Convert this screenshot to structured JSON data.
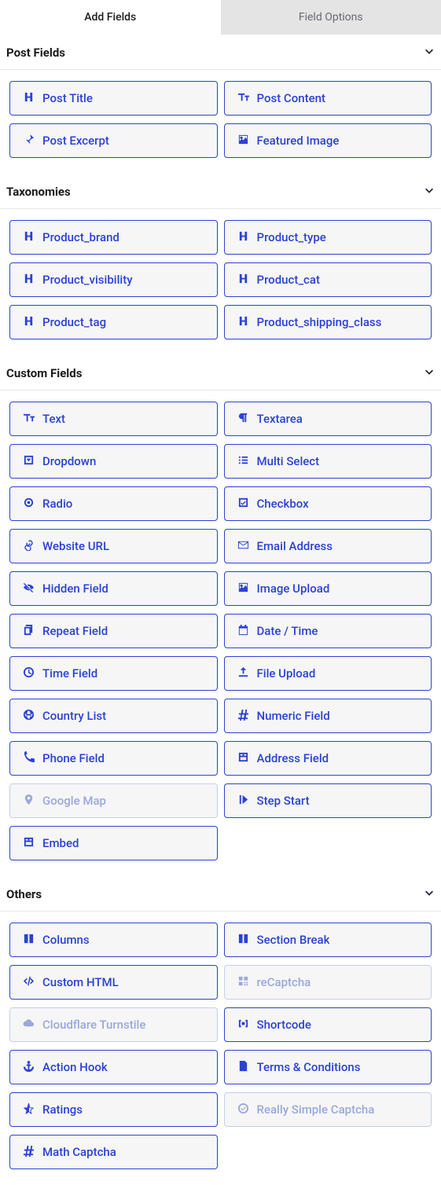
{
  "tabs": {
    "add_fields": "Add Fields",
    "field_options": "Field Options"
  },
  "sections": [
    {
      "title": "Post Fields",
      "items": [
        {
          "icon": "heading",
          "label": "Post Title"
        },
        {
          "icon": "textsize",
          "label": "Post Content"
        },
        {
          "icon": "pushpin",
          "label": "Post Excerpt"
        },
        {
          "icon": "image",
          "label": "Featured Image"
        }
      ]
    },
    {
      "title": "Taxonomies",
      "items": [
        {
          "icon": "heading",
          "label": "Product_brand"
        },
        {
          "icon": "heading",
          "label": "Product_type"
        },
        {
          "icon": "heading",
          "label": "Product_visibility"
        },
        {
          "icon": "heading",
          "label": "Product_cat"
        },
        {
          "icon": "heading",
          "label": "Product_tag"
        },
        {
          "icon": "heading",
          "label": "Product_shipping_class"
        }
      ]
    },
    {
      "title": "Custom Fields",
      "items": [
        {
          "icon": "textsize",
          "label": "Text"
        },
        {
          "icon": "para",
          "label": "Textarea"
        },
        {
          "icon": "dropdown",
          "label": "Dropdown"
        },
        {
          "icon": "list",
          "label": "Multi Select"
        },
        {
          "icon": "radio",
          "label": "Radio"
        },
        {
          "icon": "check",
          "label": "Checkbox"
        },
        {
          "icon": "link",
          "label": "Website URL"
        },
        {
          "icon": "envelope",
          "label": "Email Address"
        },
        {
          "icon": "eyeoff",
          "label": "Hidden Field"
        },
        {
          "icon": "image",
          "label": "Image Upload"
        },
        {
          "icon": "copy",
          "label": "Repeat Field"
        },
        {
          "icon": "calendar",
          "label": "Date / Time"
        },
        {
          "icon": "clock",
          "label": "Time Field"
        },
        {
          "icon": "upload",
          "label": "File Upload"
        },
        {
          "icon": "globe",
          "label": "Country List"
        },
        {
          "icon": "hash",
          "label": "Numeric Field"
        },
        {
          "icon": "phone",
          "label": "Phone Field"
        },
        {
          "icon": "address",
          "label": "Address Field"
        },
        {
          "icon": "pin",
          "label": "Google Map",
          "disabled": true
        },
        {
          "icon": "stepstart",
          "label": "Step Start"
        },
        {
          "icon": "address",
          "label": "Embed"
        }
      ]
    },
    {
      "title": "Others",
      "items": [
        {
          "icon": "columns",
          "label": "Columns"
        },
        {
          "icon": "columns",
          "label": "Section Break"
        },
        {
          "icon": "code",
          "label": "Custom HTML"
        },
        {
          "icon": "qr",
          "label": "reCaptcha",
          "disabled": true
        },
        {
          "icon": "cloud",
          "label": "Cloudflare Turnstile",
          "disabled": true
        },
        {
          "icon": "short",
          "label": "Shortcode"
        },
        {
          "icon": "anchor",
          "label": "Action Hook"
        },
        {
          "icon": "file",
          "label": "Terms & Conditions"
        },
        {
          "icon": "starhalf",
          "label": "Ratings"
        },
        {
          "icon": "circlecheck",
          "label": "Really Simple Captcha",
          "disabled": true
        },
        {
          "icon": "hash",
          "label": "Math Captcha"
        }
      ]
    }
  ]
}
